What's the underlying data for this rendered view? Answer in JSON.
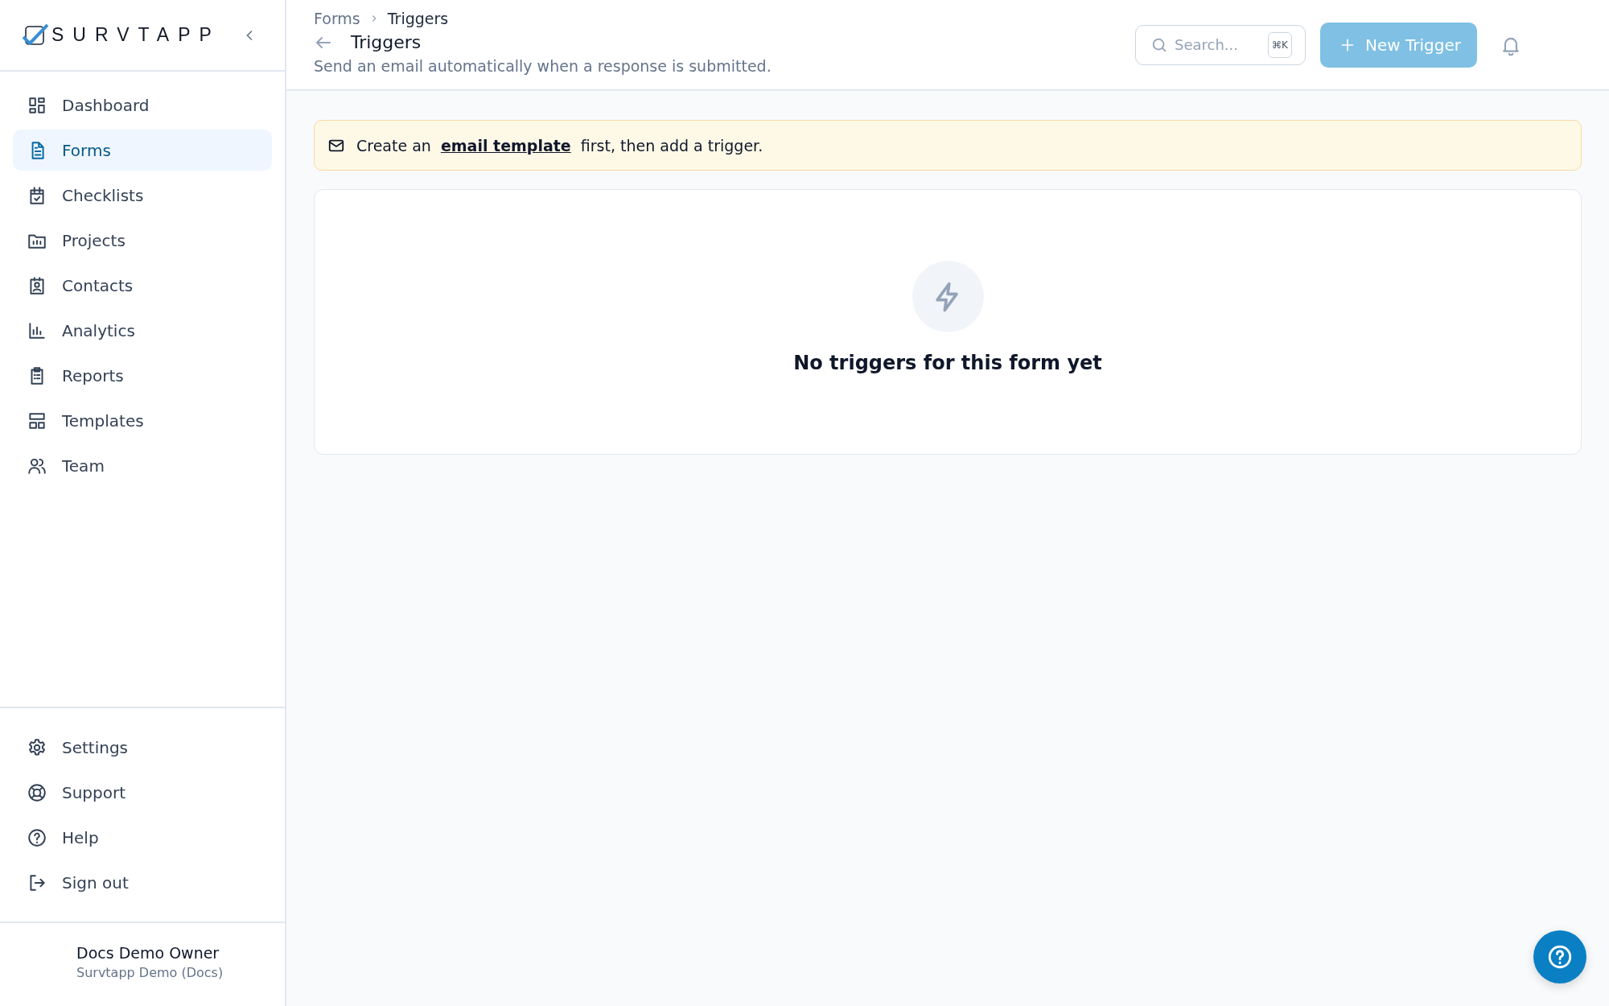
{
  "sidebar": {
    "logo": "SURVTAPP",
    "nav": [
      {
        "label": "Dashboard",
        "selected": false
      },
      {
        "label": "Forms",
        "selected": true
      },
      {
        "label": "Checklists",
        "selected": false
      },
      {
        "label": "Projects",
        "selected": false
      },
      {
        "label": "Contacts",
        "selected": false
      },
      {
        "label": "Analytics",
        "selected": false
      },
      {
        "label": "Reports",
        "selected": false
      },
      {
        "label": "Templates",
        "selected": false
      },
      {
        "label": "Team",
        "selected": false
      }
    ],
    "footer_nav": [
      {
        "label": "Settings"
      },
      {
        "label": "Support"
      },
      {
        "label": "Help"
      },
      {
        "label": "Sign out"
      }
    ],
    "user": {
      "name": "Docs Demo Owner",
      "org": "Survtapp Demo (Docs)"
    }
  },
  "header": {
    "breadcrumb": [
      "Forms",
      "Triggers"
    ],
    "title": "Triggers",
    "subtitle": "Send an email automatically when a response is submitted.",
    "search": {
      "placeholder": "Search...",
      "shortcut": "⌘K"
    },
    "new_button": "New Trigger"
  },
  "notice": {
    "before": "Create an",
    "link": "email template",
    "after": "first, then add a trigger."
  },
  "empty_state": {
    "title": "No triggers for this form yet"
  }
}
